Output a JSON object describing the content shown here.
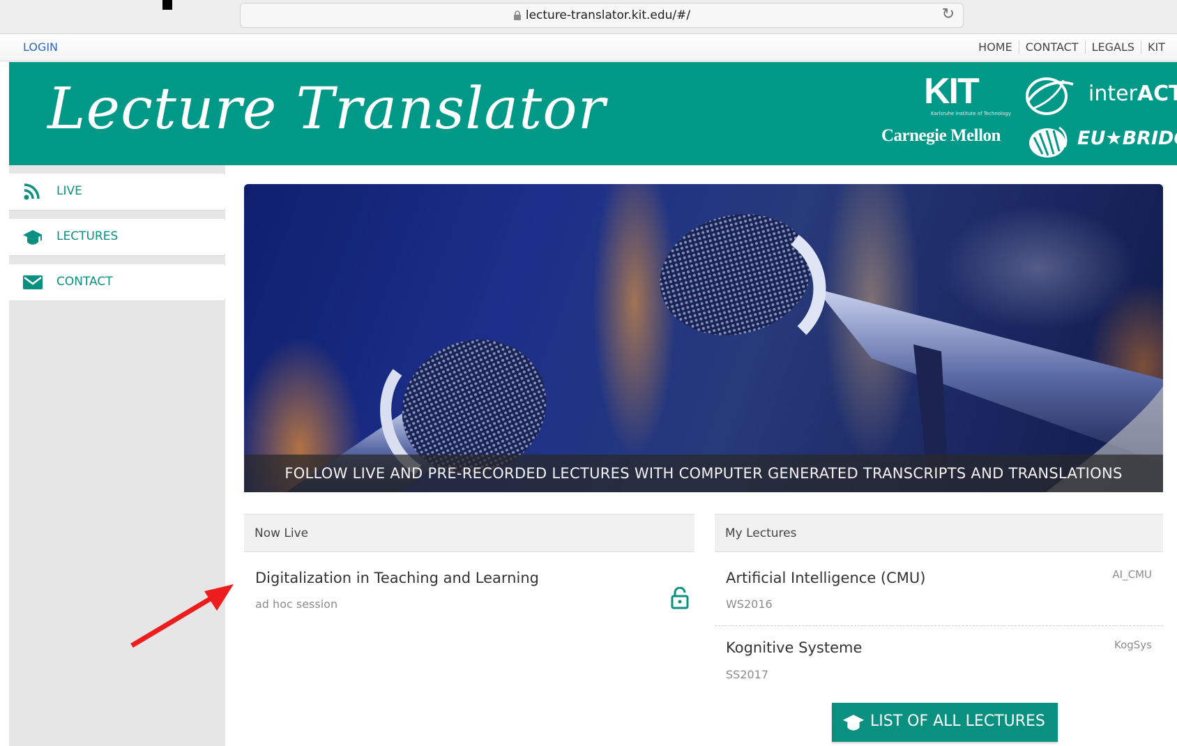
{
  "browser": {
    "url": "lecture-translator.kit.edu/#/"
  },
  "topnav": {
    "login": "LOGIN",
    "links": [
      "HOME",
      "CONTACT",
      "LEGALS",
      "KIT"
    ]
  },
  "header": {
    "title": "Lecture Translator",
    "logos": {
      "kit": "KIT",
      "kit_sub": "Karlsruhe Institute of Technology",
      "interact_a": "inter",
      "interact_b": "ACT",
      "cmu": "Carnegie Mellon",
      "eubridge": "EU★BRIDGE"
    }
  },
  "sidebar": {
    "items": [
      {
        "label": "LIVE",
        "icon": "rss-icon"
      },
      {
        "label": "LECTURES",
        "icon": "graduation-cap-icon"
      },
      {
        "label": "CONTACT",
        "icon": "envelope-icon"
      }
    ]
  },
  "hero": {
    "caption": "FOLLOW LIVE AND PRE-RECORDED LECTURES WITH COMPUTER GENERATED TRANSCRIPTS AND TRANSLATIONS"
  },
  "now_live": {
    "heading": "Now Live",
    "items": [
      {
        "title": "Digitalization in Teaching and Learning",
        "subtitle": "ad hoc session",
        "icon": "unlock-icon"
      }
    ]
  },
  "my_lectures": {
    "heading": "My Lectures",
    "items": [
      {
        "title": "Artificial Intelligence (CMU)",
        "subtitle": "WS2016",
        "code": "AI_CMU"
      },
      {
        "title": "Kognitive Systeme",
        "subtitle": "SS2017",
        "code": "KogSys"
      }
    ],
    "button": "LIST OF ALL LECTURES"
  },
  "colors": {
    "accent": "#009887",
    "text_link": "#2a67c8",
    "annotation": "#ee1c1c"
  }
}
